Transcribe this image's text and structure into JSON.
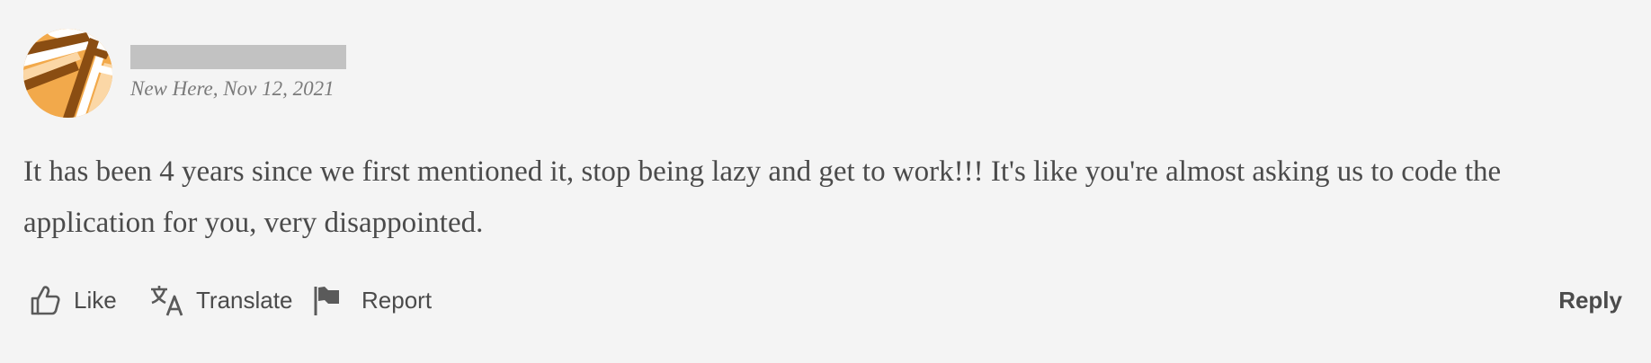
{
  "post": {
    "author": {
      "name": "",
      "rank": "New Here",
      "date": "Nov 12, 2021",
      "meta_line": "New Here, Nov 12, 2021"
    },
    "body": "It has been 4 years since we first mentioned it, stop being lazy and get to work!!! It's like you're almost asking us to code the application for you, very disappointed."
  },
  "actions": {
    "like_label": "Like",
    "translate_label": "Translate",
    "report_label": "Report",
    "reply_label": "Reply"
  },
  "icons": {
    "like": "thumbs-up-icon",
    "translate": "translate-icon",
    "report": "flag-icon"
  },
  "colors": {
    "background": "#f4f4f4",
    "text": "#4b4b4b",
    "meta_text": "#7a7a7a",
    "redaction": "#c2c2c2",
    "avatar_orange": "#f2a94b",
    "avatar_brown": "#8a4d12"
  }
}
